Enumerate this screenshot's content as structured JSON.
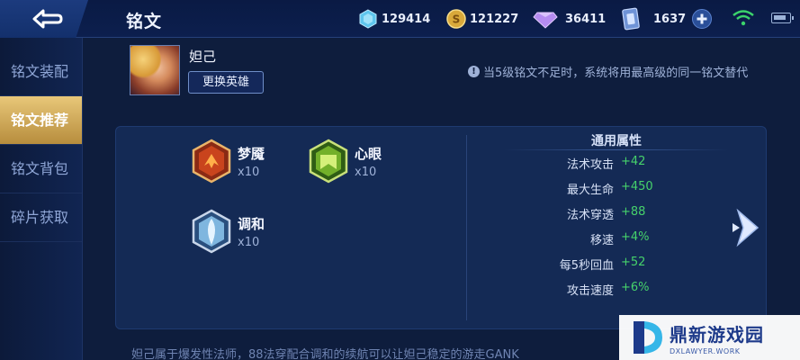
{
  "header": {
    "title": "铭文",
    "resources": [
      {
        "icon": "diamond-icon",
        "value": "129414"
      },
      {
        "icon": "gold-coin-icon",
        "value": "121227"
      },
      {
        "icon": "purple-gem-icon",
        "value": "36411"
      },
      {
        "icon": "voucher-icon",
        "value": "1637"
      }
    ]
  },
  "sidebar": {
    "items": [
      {
        "label": "铭文装配",
        "active": false
      },
      {
        "label": "铭文推荐",
        "active": true
      },
      {
        "label": "铭文背包",
        "active": false
      },
      {
        "label": "碎片获取",
        "active": false
      }
    ]
  },
  "hero": {
    "name": "妲己",
    "change_label": "更换英雄"
  },
  "notice": "当5级铭文不足时，系统将用最高级的同一铭文替代",
  "inscriptions": [
    {
      "name": "梦魇",
      "count": "x10",
      "color": "red"
    },
    {
      "name": "心眼",
      "count": "x10",
      "color": "green"
    },
    {
      "name": "调和",
      "count": "x10",
      "color": "blue"
    }
  ],
  "attributes": {
    "title": "通用属性",
    "rows": [
      {
        "name": "法术攻击",
        "value": "+42"
      },
      {
        "name": "最大生命",
        "value": "+450"
      },
      {
        "name": "法术穿透",
        "value": "+88"
      },
      {
        "name": "移速",
        "value": "+4%"
      },
      {
        "name": "每5秒回血",
        "value": "+52"
      },
      {
        "name": "攻击速度",
        "value": "+6%"
      }
    ]
  },
  "description": "妲己属于爆发性法师，88法穿配合调和的续航可以让妲己稳定的游走GANK",
  "watermark": {
    "title": "鼎新游戏园",
    "subtitle": "DXLAWYER.WORK"
  },
  "colors": {
    "accent_gold": "#d9b25a",
    "attr_green": "#46d26b",
    "panel_bg": "#142a55"
  }
}
